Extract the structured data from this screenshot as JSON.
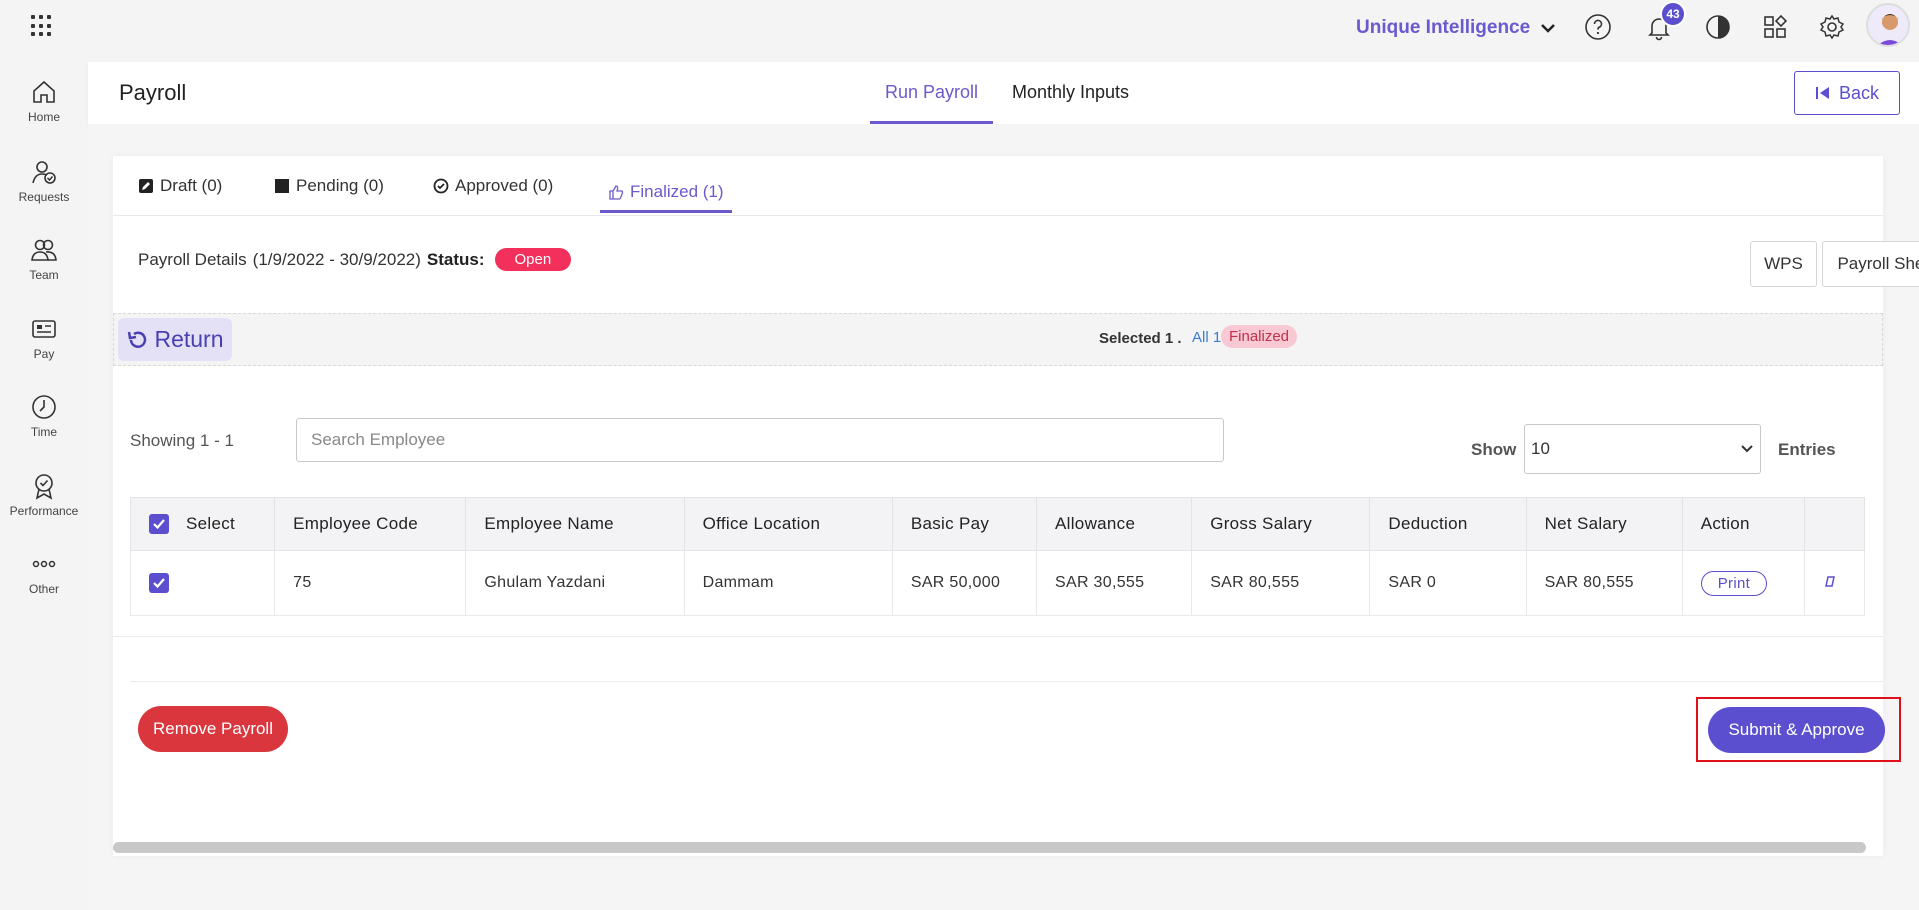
{
  "topbar": {
    "org_name": "Unique Intelligence",
    "notification_count": "43"
  },
  "sidebar": {
    "items": [
      {
        "label": "Home",
        "icon": "home-icon"
      },
      {
        "label": "Requests",
        "icon": "requests-icon"
      },
      {
        "label": "Team",
        "icon": "team-icon"
      },
      {
        "label": "Pay",
        "icon": "pay-icon"
      },
      {
        "label": "Time",
        "icon": "clock-icon"
      },
      {
        "label": "Performance",
        "icon": "badge-icon"
      },
      {
        "label": "Other",
        "icon": "more-icon"
      }
    ]
  },
  "header": {
    "title": "Payroll",
    "tabs": [
      {
        "label": "Run Payroll",
        "active": true
      },
      {
        "label": "Monthly Inputs",
        "active": false
      }
    ],
    "back_label": "Back"
  },
  "subtabs": [
    {
      "label": "Draft (0)",
      "icon": "edit-icon"
    },
    {
      "label": "Pending (0)",
      "icon": "square-icon"
    },
    {
      "label": "Approved (0)",
      "icon": "check-circle-icon"
    },
    {
      "label": "Finalized (1)",
      "icon": "thumbs-up-icon",
      "active": true
    }
  ],
  "details": {
    "label": "Payroll Details",
    "period": "(1/9/2022 - 30/9/2022)",
    "status_label": "Status:",
    "status_value": "Open",
    "wps_label": "WPS",
    "sheet_label": "Payroll Sheet"
  },
  "selection": {
    "return_label": "Return",
    "selected_text": "Selected 1 .",
    "all_text": "All 1",
    "finalized_text": "Finalized"
  },
  "listing": {
    "showing_text": "Showing 1 - 1",
    "search_placeholder": "Search Employee",
    "show_label": "Show",
    "entries_value": "10",
    "entries_label": "Entries"
  },
  "table": {
    "headers": [
      "Select",
      "Employee Code",
      "Employee Name",
      "Office Location",
      "Basic Pay",
      "Allowance",
      "Gross Salary",
      "Deduction",
      "Net Salary",
      "Action",
      ""
    ],
    "rows": [
      {
        "code": "75",
        "name": "Ghulam Yazdani",
        "location": "Dammam",
        "basic": "SAR 50,000",
        "allowance": "SAR 30,555",
        "gross": "SAR 80,555",
        "deduction": "SAR 0",
        "net": "SAR 80,555",
        "action": "Print"
      }
    ]
  },
  "footer": {
    "remove_label": "Remove Payroll",
    "submit_label": "Submit & Approve"
  },
  "colors": {
    "accent": "#5b4fcf",
    "danger": "#d9363e",
    "status_open": "#f2305b"
  }
}
